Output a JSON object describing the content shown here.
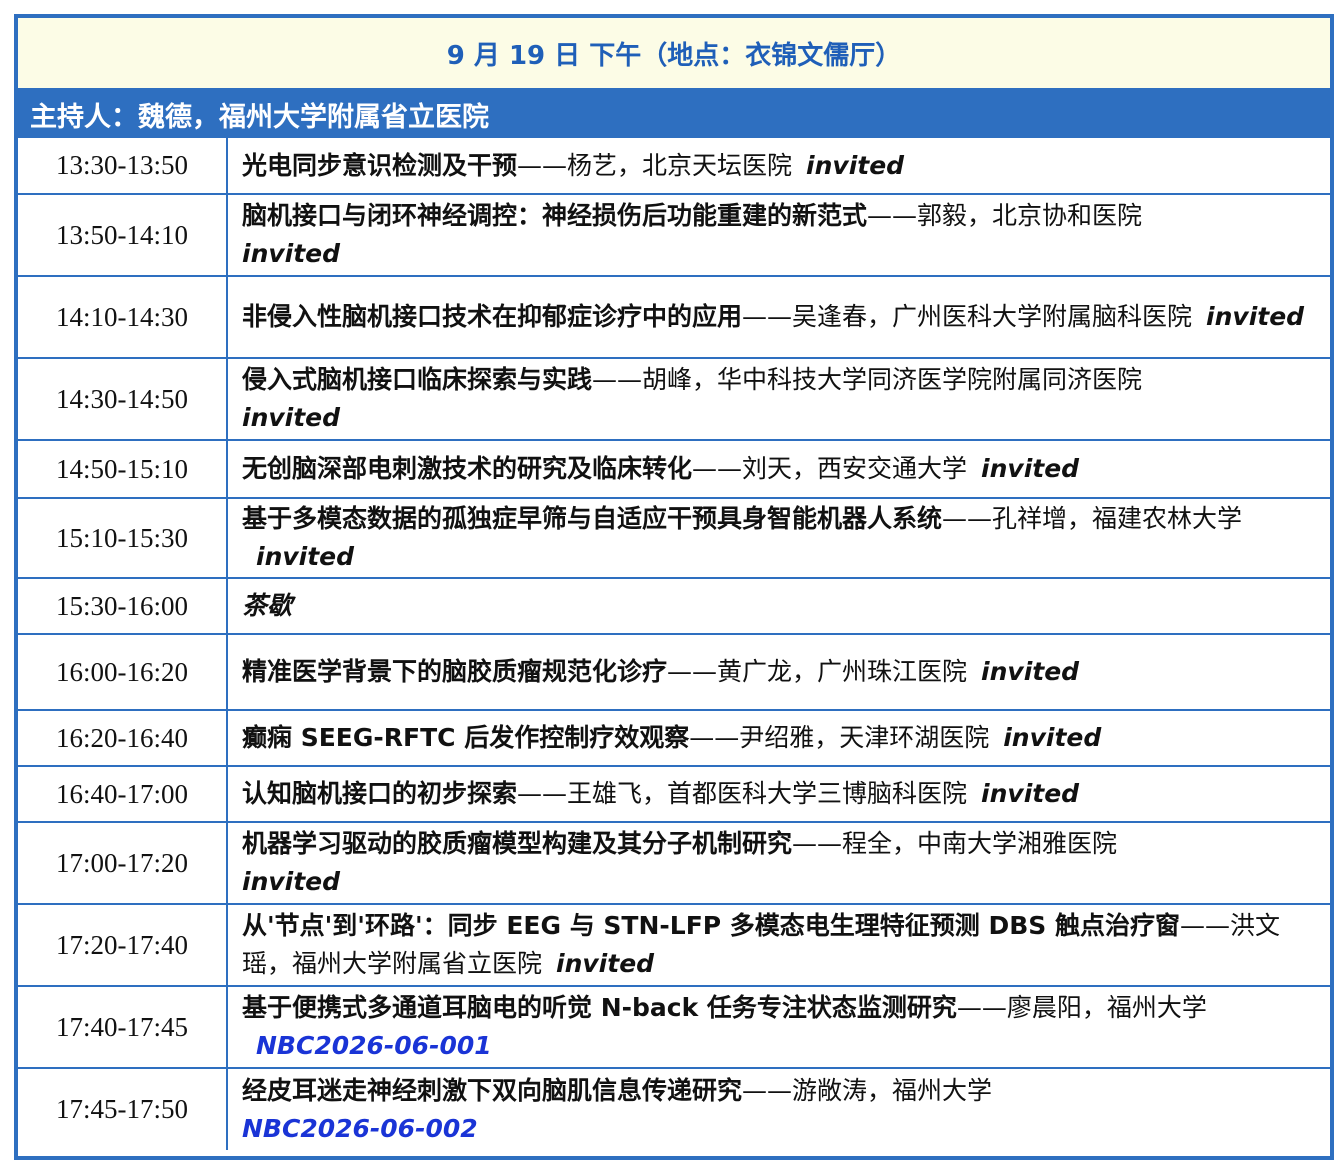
{
  "session_header": "9 月 19 日  下午（地点：衣锦文儒厅）",
  "host": "主持人：魏德，福州大学附属省立医院",
  "rows": [
    {
      "time": "13:30-13:50",
      "title": "光电同步意识检测及干预",
      "speaker": "——杨艺，北京天坛医院",
      "tag": "invited"
    },
    {
      "time": "13:50-14:10",
      "title": "脑机接口与闭环神经调控：神经损伤后功能重建的新范式",
      "speaker": "——郭毅，北京协和医院",
      "tag": "invited"
    },
    {
      "time": "14:10-14:30",
      "title": "非侵入性脑机接口技术在抑郁症诊疗中的应用",
      "speaker": "——吴逢春，广州医科大学附属脑科医院",
      "tag": "invited"
    },
    {
      "time": "14:30-14:50",
      "title": "侵入式脑机接口临床探索与实践",
      "speaker": "——胡峰，华中科技大学同济医学院附属同济医院",
      "tag": "invited"
    },
    {
      "time": "14:50-15:10",
      "title": "无创脑深部电刺激技术的研究及临床转化",
      "speaker": "——刘天，西安交通大学",
      "tag": "invited"
    },
    {
      "time": "15:10-15:30",
      "title": "基于多模态数据的孤独症早筛与自适应干预具身智能机器人系统",
      "speaker": "——孔祥增，福建农林大学",
      "tag": "invited"
    },
    {
      "time": "15:30-16:00",
      "break_label": "茶歇"
    },
    {
      "time": "16:00-16:20",
      "title": "精准医学背景下的脑胶质瘤规范化诊疗",
      "speaker": "——黄广龙，广州珠江医院",
      "tag": "invited"
    },
    {
      "time": "16:20-16:40",
      "title": "癫痫 SEEG-RFTC 后发作控制疗效观察",
      "speaker": "——尹绍雅，天津环湖医院",
      "tag": "invited"
    },
    {
      "time": "16:40-17:00",
      "title": "认知脑机接口的初步探索",
      "speaker": "——王雄飞，首都医科大学三博脑科医院",
      "tag": "invited"
    },
    {
      "time": "17:00-17:20",
      "title": "机器学习驱动的胶质瘤模型构建及其分子机制研究",
      "speaker": "——程全，中南大学湘雅医院",
      "tag": "invited"
    },
    {
      "time": "17:20-17:40",
      "title": "从'节点'到'环路'：同步 EEG 与 STN-LFP 多模态电生理特征预测 DBS 触点治疗窗",
      "speaker": "——洪文瑶，福州大学附属省立医院",
      "tag": "invited"
    },
    {
      "time": "17:40-17:45",
      "title": "基于便携式多通道耳脑电的听觉 N-back 任务专注状态监测研究",
      "speaker": "——廖晨阳，福州大学",
      "code": "NBC2026-06-001"
    },
    {
      "time": "17:45-17:50",
      "title": "经皮耳迷走神经刺激下双向脑肌信息传递研究",
      "speaker": "——游敞涛，福州大学",
      "code": "NBC2026-06-002"
    }
  ],
  "colors": {
    "border": "#2E6FC0",
    "header_bg": "#FCFCE6",
    "header_text": "#1F5FB8",
    "code_text": "#1A34D6"
  }
}
